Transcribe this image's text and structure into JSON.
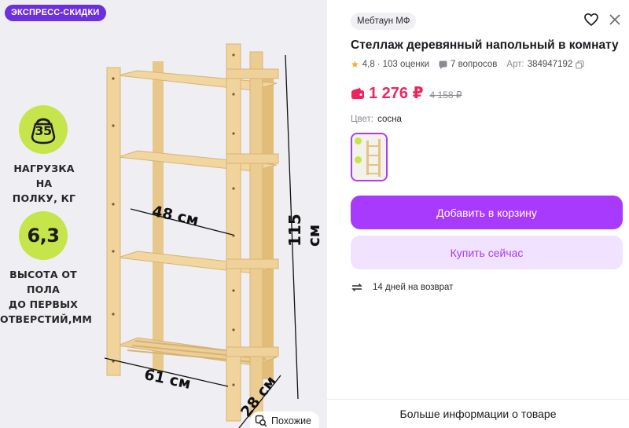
{
  "image_panel": {
    "badge": "ЭКСПРЕСС-СКИДКИ",
    "specs": [
      {
        "value": "35",
        "icon": "kettlebell-icon",
        "label_lines": [
          "НАГРУЗКА НА",
          "ПОЛКУ, КГ"
        ]
      },
      {
        "value": "6,3",
        "label_lines": [
          "ВЫСОТА ОТ ПОЛА",
          "ДО ПЕРВЫХ",
          "ОТВЕРСТИЙ,ММ"
        ]
      }
    ],
    "dimensions": {
      "depth_top": "48 см",
      "width": "61 см",
      "height": "115 см",
      "depth": "28 см"
    },
    "similar_button": "Похожие",
    "accent_color": "#c6e44b"
  },
  "info": {
    "seller": "Мебтаун МФ",
    "title": "Стеллаж деревянный напольный в комнату",
    "rating": "4,8",
    "reviews": "103 оценки",
    "questions": "7 вопросов",
    "article_label": "Арт:",
    "article_value": "384947192",
    "price": "1 276 ₽",
    "old_price": "4 158 ₽",
    "color_label": "Цвет:",
    "color_value": "сосна",
    "add_to_cart": "Добавить в корзину",
    "buy_now": "Купить сейчас",
    "return_text": "14 дней на возврат",
    "more_info": "Больше информации о товаре",
    "colors": {
      "brand": "#a73afd",
      "price": "#f0245b",
      "secondary_bg": "#f1e2ff"
    }
  }
}
